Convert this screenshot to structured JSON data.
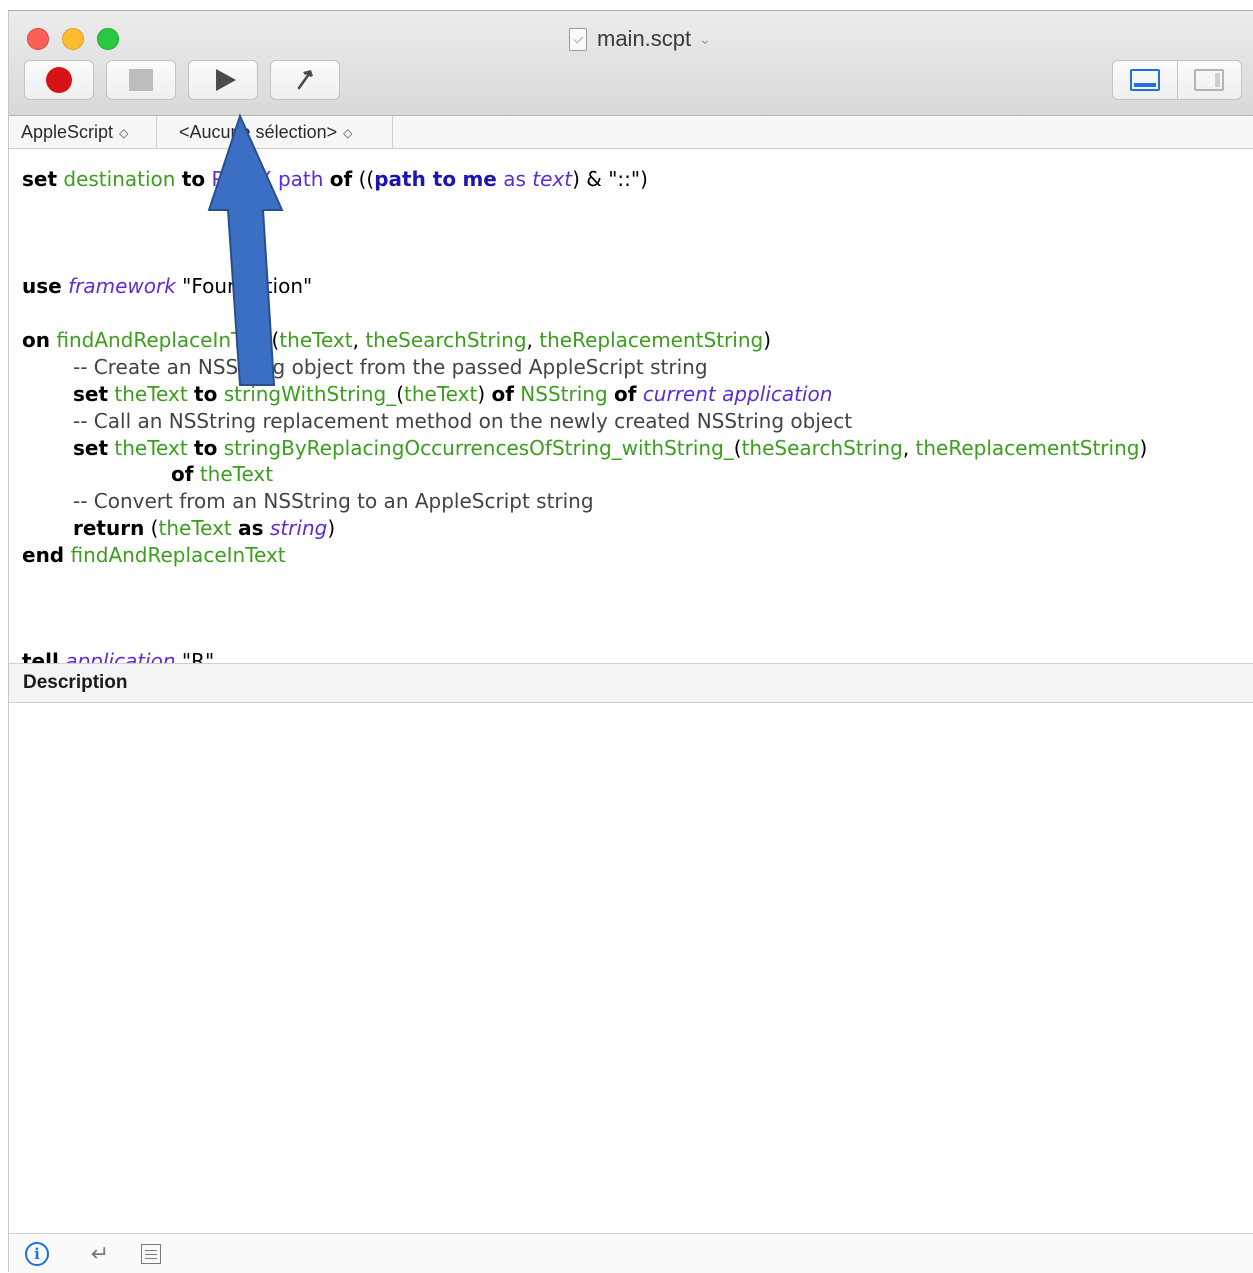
{
  "window": {
    "title": "main.scpt",
    "title_icon": "document-icon",
    "title_chevron": "⌄"
  },
  "toolbar": {
    "buttons": [
      {
        "name": "record",
        "icon": "record-icon",
        "color": "#d91218"
      },
      {
        "name": "stop",
        "icon": "stop-icon"
      },
      {
        "name": "run",
        "icon": "play-icon"
      },
      {
        "name": "compile",
        "icon": "hammer-icon"
      }
    ],
    "view_toggle": [
      "bottom-pane-icon",
      "side-pane-icon"
    ]
  },
  "navigator": {
    "language": "AppleScript",
    "selection": "<Aucune sélection>",
    "arrows": "◇"
  },
  "editor": {
    "lines": [
      [
        "set",
        " ",
        "destination",
        " ",
        "to",
        " ",
        "POSIX path",
        " ",
        "of",
        " ((",
        "path to",
        " ",
        "me",
        " ",
        "as",
        " ",
        "text",
        ") & \"::\")"
      ],
      [
        "use",
        " ",
        "framework",
        " \"Foundation\""
      ],
      [
        "on",
        " ",
        "findAndReplaceInText",
        "(",
        "theText",
        ", ",
        "theSearchString",
        ", ",
        "theReplacementString",
        ")"
      ],
      [
        "-- Create an NSString object from the passed AppleScript string"
      ],
      [
        "set",
        " ",
        "theText",
        " ",
        "to",
        " ",
        "stringWithString_",
        "(",
        "theText",
        ") ",
        "of",
        " ",
        "NSString",
        " ",
        "of",
        " ",
        "current application"
      ],
      [
        "-- Call an NSString replacement method on the newly created NSString object"
      ],
      [
        "set",
        " ",
        "theText",
        " ",
        "to",
        " ",
        "stringByReplacingOccurrencesOfString_withString_",
        "(",
        "theSearchString",
        ", ",
        "theReplacementString",
        ")"
      ],
      [
        "of",
        " ",
        "theText"
      ],
      [
        "-- Convert from an NSString to an AppleScript string"
      ],
      [
        "return",
        " (",
        "theText",
        " ",
        "as",
        " ",
        "string",
        ")"
      ],
      [
        "end",
        " ",
        "findAndReplaceInText"
      ],
      [
        "tell",
        " ",
        "application",
        " \"R\""
      ]
    ]
  },
  "description": {
    "header": "Description"
  },
  "statusbar": {
    "icons": [
      "info-icon",
      "return-icon",
      "list-icon"
    ],
    "info_glyph": "i",
    "return_glyph": "↵"
  },
  "annotation": {
    "arrow_color": "#3b6fc4"
  }
}
